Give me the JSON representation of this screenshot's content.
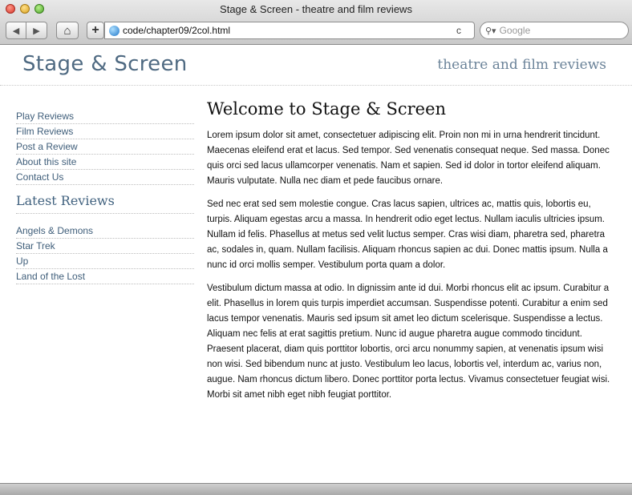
{
  "window": {
    "title": "Stage & Screen - theatre and film reviews",
    "url": "code/chapter09/2col.html",
    "search_placeholder": "Google",
    "back_glyph": "◀",
    "forward_glyph": "▶",
    "home_glyph": "⌂",
    "add_glyph": "+",
    "reload_glyph": "c"
  },
  "header": {
    "site_name": "Stage & Screen",
    "tagline": "theatre and film reviews"
  },
  "sidebar": {
    "nav": [
      {
        "label": "Play Reviews"
      },
      {
        "label": "Film Reviews"
      },
      {
        "label": "Post a Review"
      },
      {
        "label": "About this site"
      },
      {
        "label": "Contact Us"
      }
    ],
    "latest_heading": "Latest Reviews",
    "latest": [
      {
        "label": "Angels & Demons"
      },
      {
        "label": "Star Trek"
      },
      {
        "label": "Up"
      },
      {
        "label": "Land of the Lost"
      }
    ]
  },
  "main": {
    "title": "Welcome to Stage & Screen",
    "paragraphs": [
      "Lorem ipsum dolor sit amet, consectetuer adipiscing elit. Proin non mi in urna hendrerit tincidunt. Maecenas eleifend erat et lacus. Sed tempor. Sed venenatis consequat neque. Sed massa. Donec quis orci sed lacus ullamcorper venenatis. Nam et sapien. Sed id dolor in tortor eleifend aliquam. Mauris vulputate. Nulla nec diam et pede faucibus ornare.",
      "Sed nec erat sed sem molestie congue. Cras lacus sapien, ultrices ac, mattis quis, lobortis eu, turpis. Aliquam egestas arcu a massa. In hendrerit odio eget lectus. Nullam iaculis ultricies ipsum. Nullam id felis. Phasellus at metus sed velit luctus semper. Cras wisi diam, pharetra sed, pharetra ac, sodales in, quam. Nullam facilisis. Aliquam rhoncus sapien ac dui. Donec mattis ipsum. Nulla a nunc id orci mollis semper. Vestibulum porta quam a dolor.",
      "Vestibulum dictum massa at odio. In dignissim ante id dui. Morbi rhoncus elit ac ipsum. Curabitur a elit. Phasellus in lorem quis turpis imperdiet accumsan. Suspendisse potenti. Curabitur a enim sed lacus tempor venenatis. Mauris sed ipsum sit amet leo dictum scelerisque. Suspendisse a lectus. Aliquam nec felis at erat sagittis pretium. Nunc id augue pharetra augue commodo tincidunt. Praesent placerat, diam quis porttitor lobortis, orci arcu nonummy sapien, at venenatis ipsum wisi non wisi. Sed bibendum nunc at justo. Vestibulum leo lacus, lobortis vel, interdum ac, varius non, augue. Nam rhoncus dictum libero. Donec porttitor porta lectus. Vivamus consectetuer feugiat wisi. Morbi sit amet nibh eget nibh feugiat porttitor."
    ]
  },
  "colors": {
    "link": "#3f5e7a",
    "site_name": "#4f6a82",
    "tagline": "#6b8399"
  }
}
